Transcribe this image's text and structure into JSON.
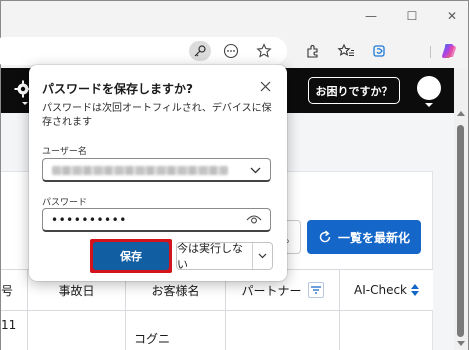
{
  "window": {
    "controls": {
      "minimize": "—",
      "maximize": "☐",
      "close": "✕"
    }
  },
  "toolbar": {
    "icons": [
      "key-icon",
      "ellipsis-circle-icon",
      "star-icon",
      "extensions-icon",
      "favorites-icon",
      "collections-icon",
      "copilot-icon"
    ]
  },
  "app": {
    "help_button": "お困りですか？"
  },
  "main": {
    "refresh_button": "一覧を最新化",
    "ghost_button_text": "。",
    "table": {
      "headers": [
        "号",
        "事故日",
        "お客様名",
        "パートナー",
        "AI-Check"
      ],
      "rows": [
        {
          "id": "11",
          "accident_date": "",
          "customer": "コグニ",
          "partner": "",
          "ai_check": ""
        }
      ]
    }
  },
  "popup": {
    "title": "パスワードを保存しますか?",
    "description": "パスワードは次回オートフィルされ、デバイスに保存されます",
    "username_label": "ユーザー名",
    "password_label": "パスワード",
    "password_value": "••••••••••",
    "save_button": "保存",
    "never_button": "今は実行しない"
  },
  "colors": {
    "accent_blue": "#1466c9",
    "save_blue": "#115ea3",
    "highlight_red": "#d4141c",
    "header_black": "#0c0c0c"
  }
}
